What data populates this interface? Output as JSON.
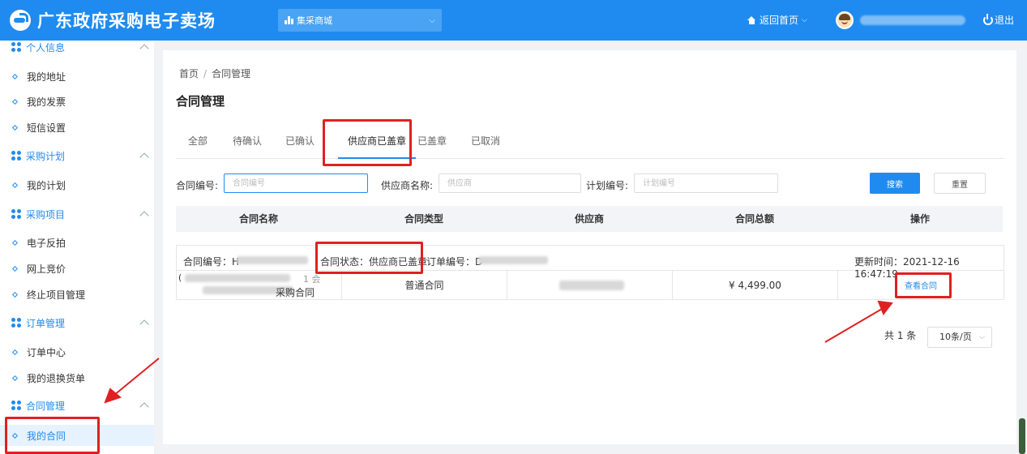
{
  "header": {
    "site_name": "广东政府采购电子卖场",
    "mall_select": "集采商城",
    "back_home": "返回首页",
    "logout": "退出",
    "colors": {
      "primary": "#1f8bf0"
    }
  },
  "sidebar": {
    "groups": [
      {
        "label": "个人信息",
        "items": [
          "我的地址",
          "我的发票",
          "短信设置"
        ]
      },
      {
        "label": "采购计划",
        "items": [
          "我的计划"
        ]
      },
      {
        "label": "采购项目",
        "items": [
          "电子反拍",
          "网上竞价",
          "终止项目管理"
        ]
      },
      {
        "label": "订单管理",
        "items": [
          "订单中心",
          "我的退换货单"
        ]
      },
      {
        "label": "合同管理",
        "items": [
          "我的合同"
        ]
      }
    ]
  },
  "main": {
    "breadcrumb": [
      "首页",
      "合同管理"
    ],
    "breadcrumb_sep": "/",
    "title": "合同管理",
    "tabs": [
      "全部",
      "待确认",
      "已确认",
      "供应商已盖章",
      "已盖章",
      "已取消"
    ],
    "active_tab": "供应商已盖章",
    "filters": {
      "contract_no_label": "合同编号:",
      "contract_no_placeholder": "合同编号",
      "supplier_label": "供应商名称:",
      "supplier_placeholder": "供应商",
      "plan_no_label": "计划编号:",
      "plan_no_placeholder": "计划编号",
      "search_button": "搜索",
      "reset_button": "重置"
    },
    "table": {
      "headers": [
        "合同名称",
        "合同类型",
        "供应商",
        "合同总额",
        "操作"
      ],
      "order": {
        "contract_no_label": "合同编号：H",
        "status": "合同状态：供应商已盖章",
        "order_no_label": "订单编号：D",
        "updated": "更新时间：2021-12-16 16:47:19",
        "name_fragment_1": "(",
        "name_fragment_2": "1 会",
        "name_fragment_3": "采购合同",
        "type": "普通合同",
        "amount": "¥ 4,499.00",
        "action": "查看合同"
      }
    },
    "pagination": {
      "total": "共 1 条",
      "page_size": "10条/页"
    }
  }
}
